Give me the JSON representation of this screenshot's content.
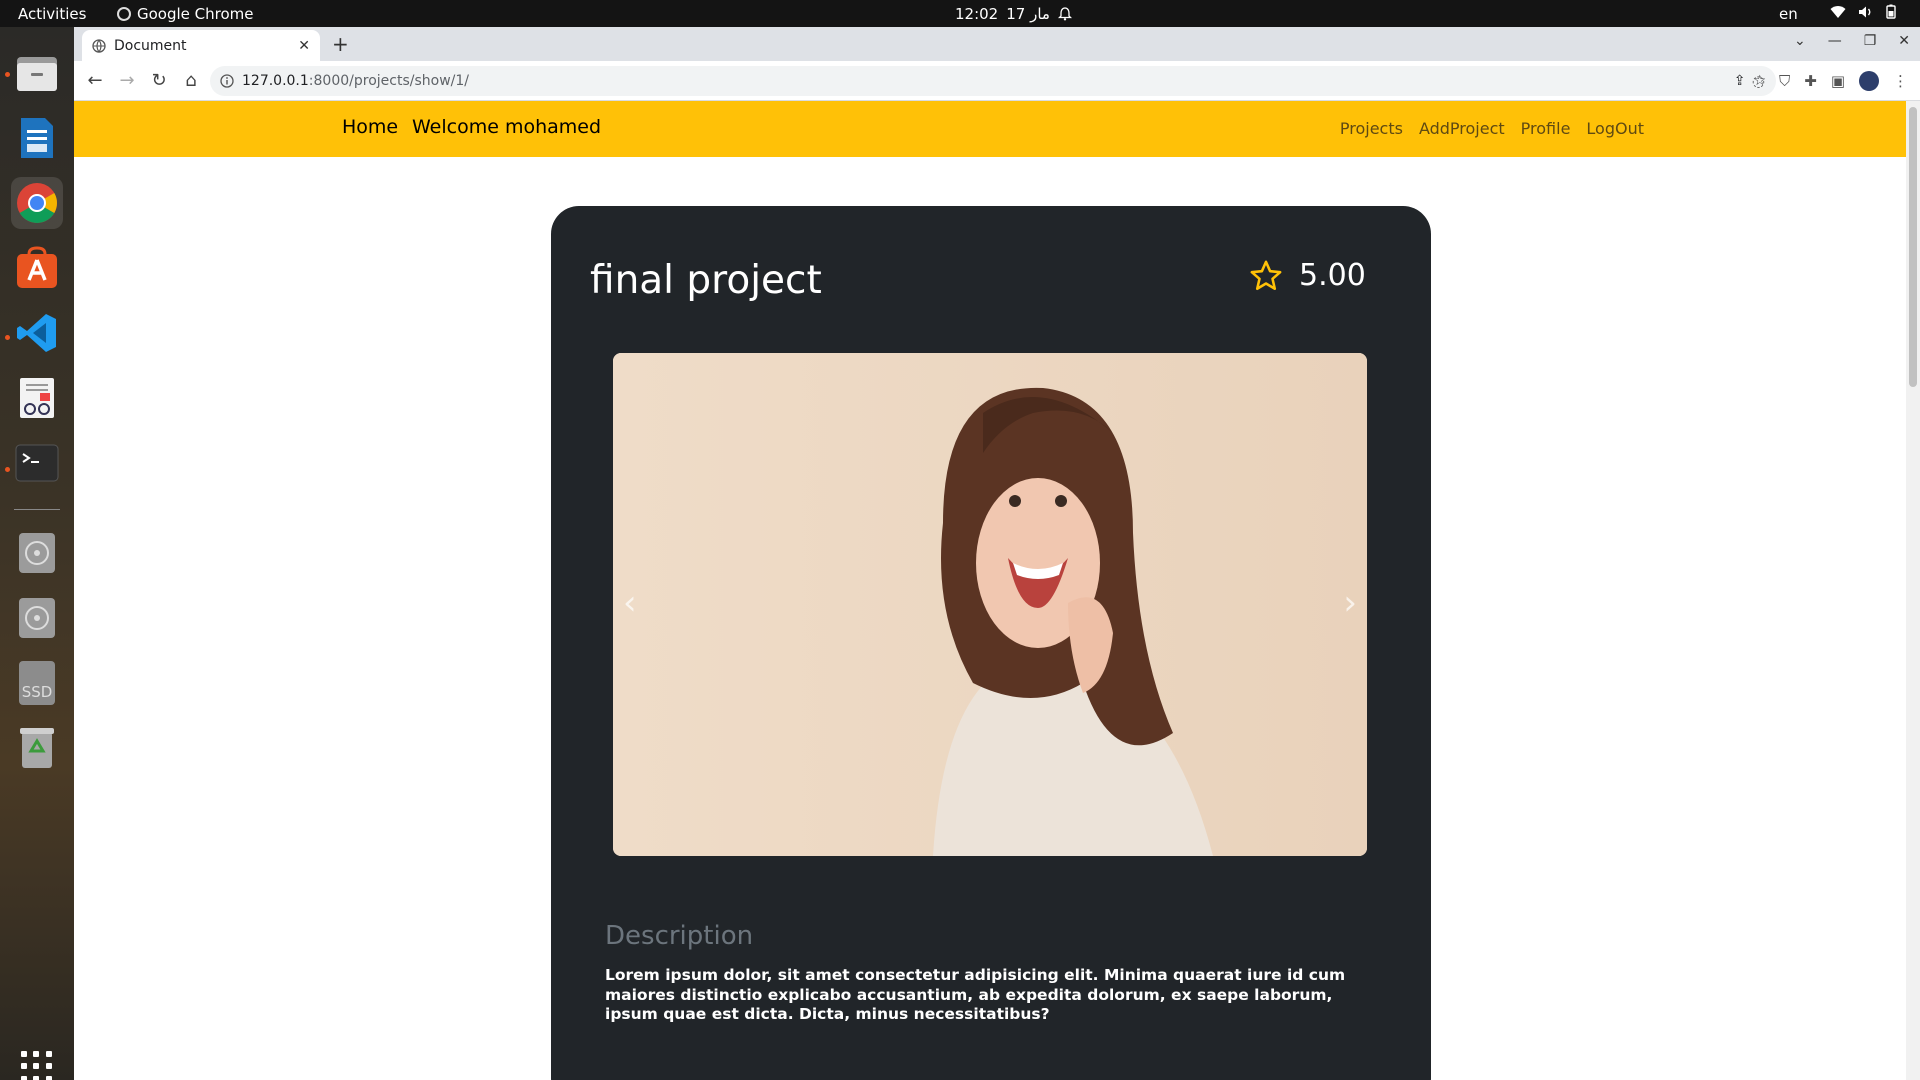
{
  "os": {
    "activities": "Activities",
    "app_name": "Google Chrome",
    "clock": "12:02",
    "date": "17 مار",
    "lang": "en"
  },
  "browser": {
    "tab_title": "Document",
    "url_host": "127.0.0.1",
    "url_path": ":8000/projects/show/1/"
  },
  "site": {
    "brand": "Home",
    "welcome": "Welcome mohamed",
    "links": [
      "Projects",
      "AddProject",
      "Profile",
      "LogOut"
    ],
    "accent": "#ffc107"
  },
  "project": {
    "title": "final project",
    "rating": "5.00",
    "description_heading": "Description",
    "description": "Lorem ipsum dolor, sit amet consectetur adipisicing elit. Minima quaerat iure id cum maiores distinctio explicabo accusantium, ab expedita dolorum, ex saepe laborum, ipsum quae est dicta. Dicta, minus necessitatibus?"
  },
  "dock": {
    "ssd_label": "SSD"
  }
}
